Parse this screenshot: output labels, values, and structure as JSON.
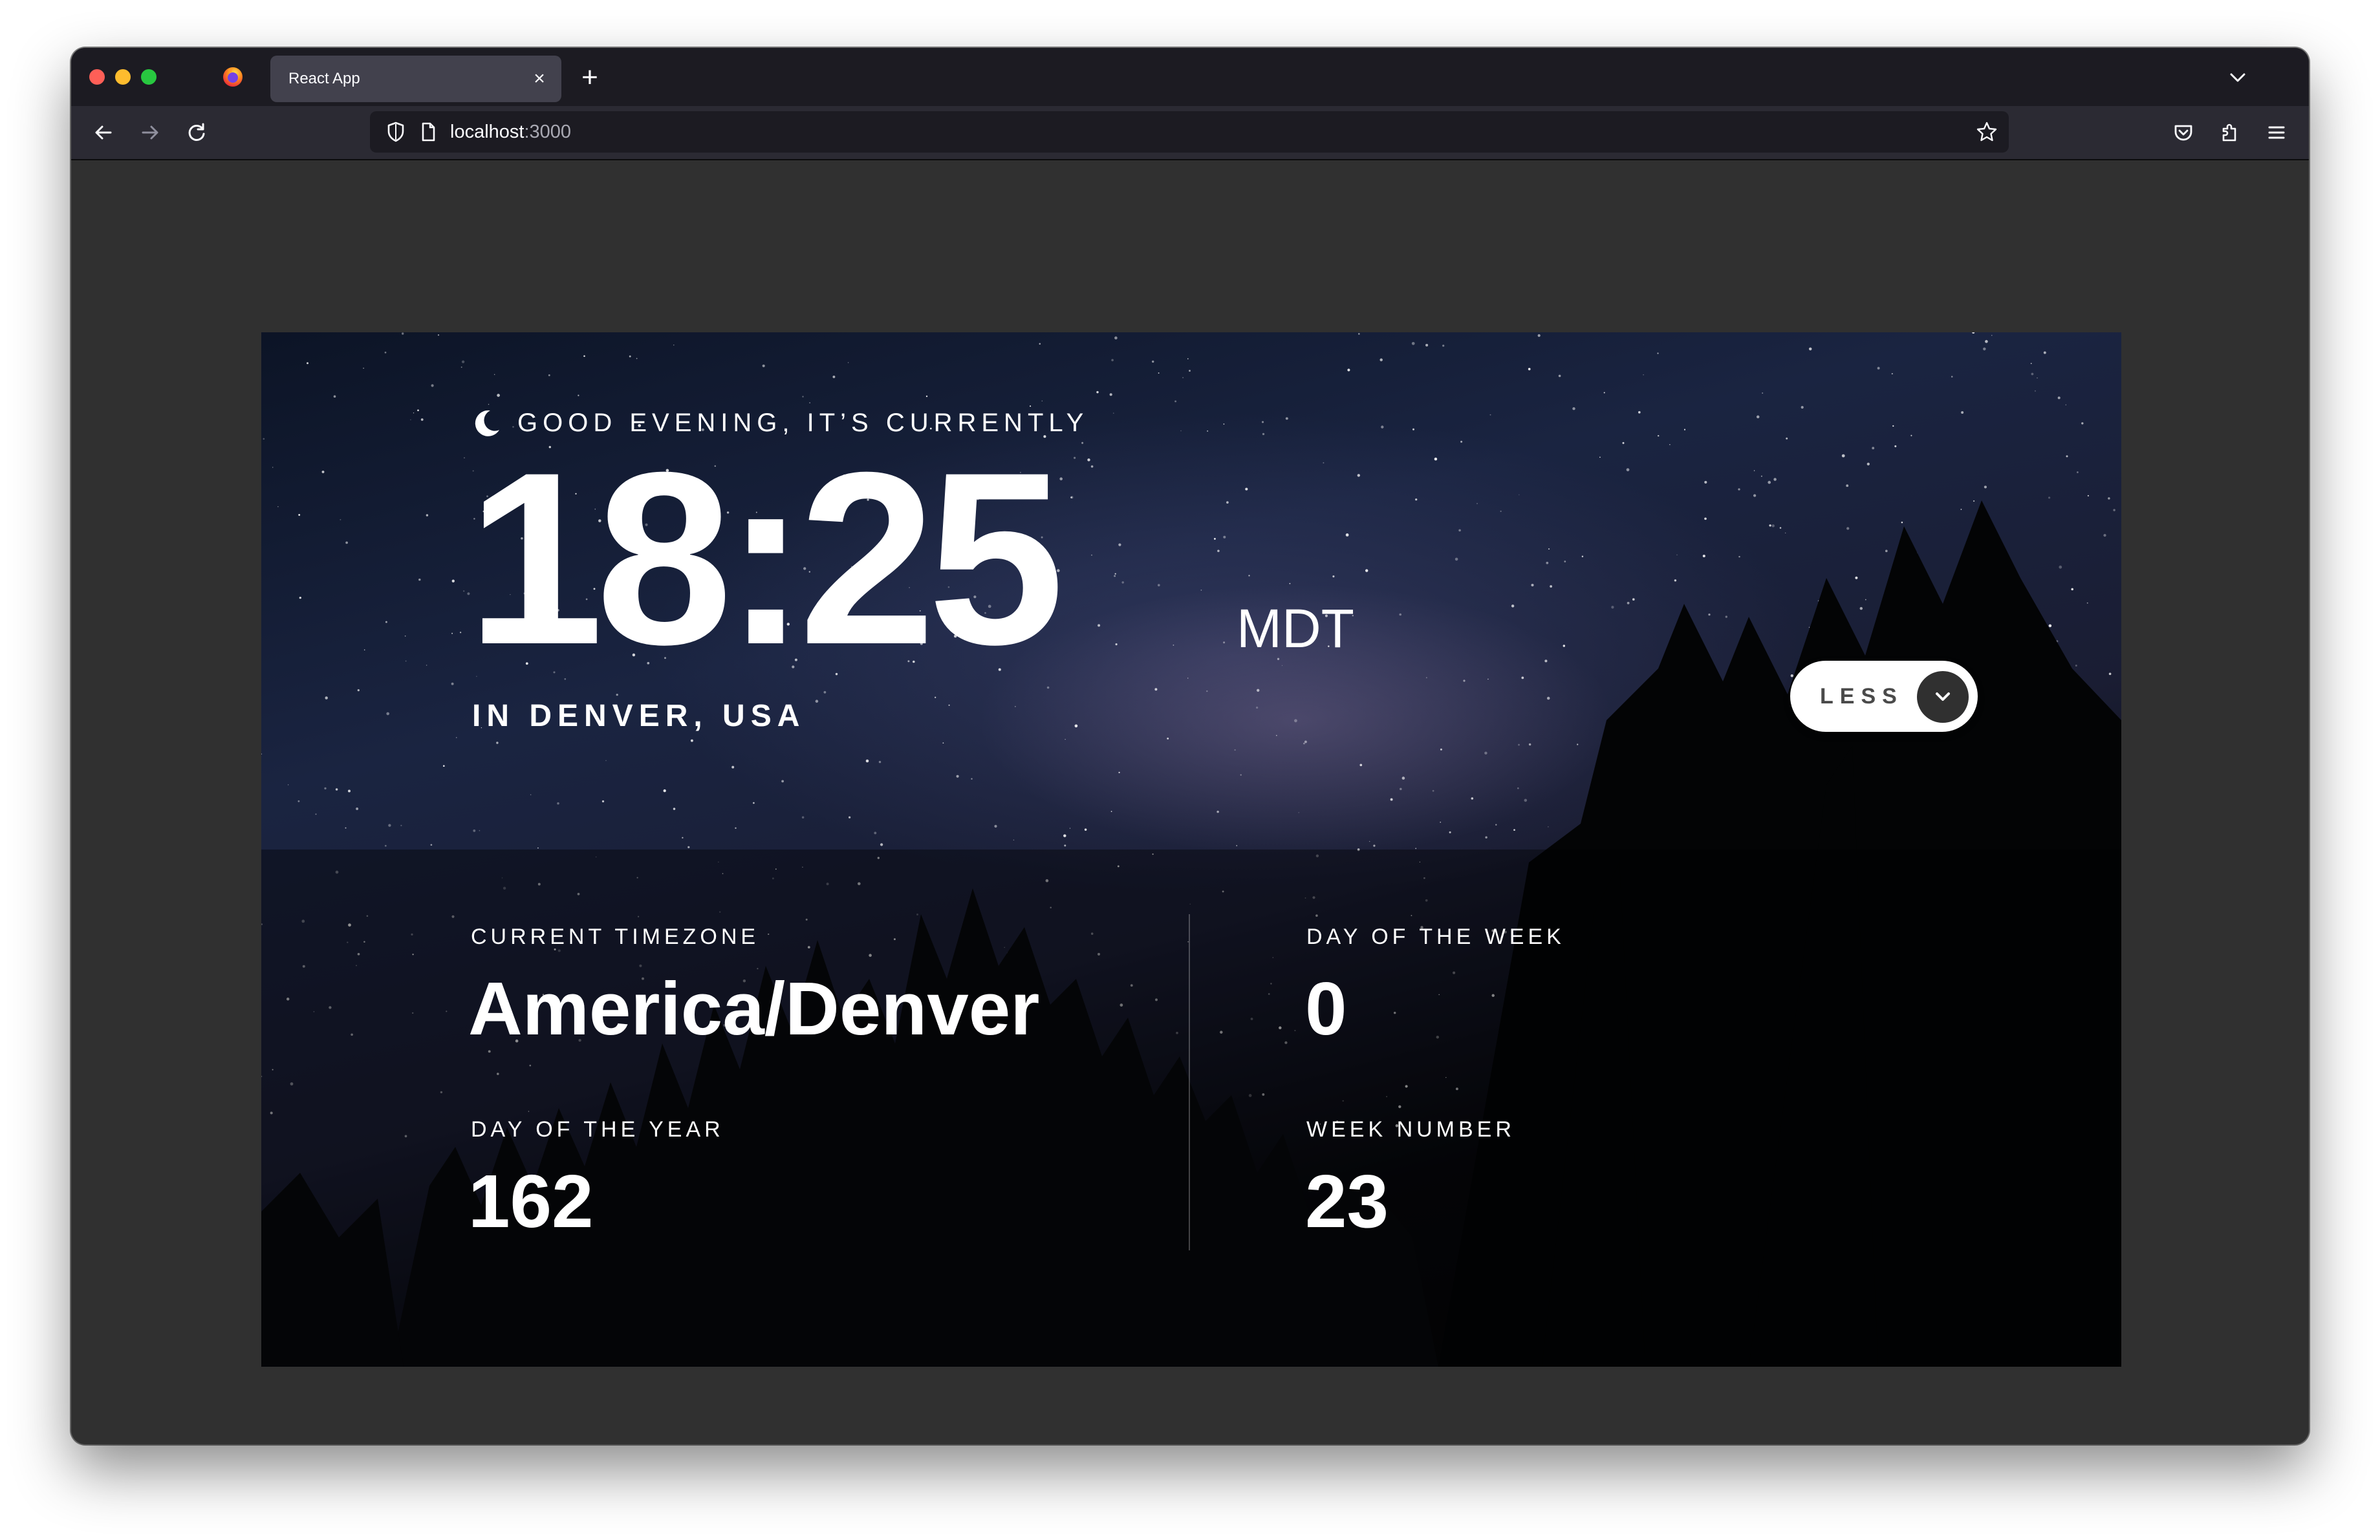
{
  "browser": {
    "tab_title": "React App",
    "tab_close": "×",
    "new_tab": "+",
    "url_host": "localhost",
    "url_port": ":3000"
  },
  "app": {
    "greeting": "GOOD EVENING, IT’S CURRENTLY",
    "time": "18:25",
    "timezone_abbr": "MDT",
    "location": "IN DENVER, USA",
    "toggle_label": "LESS",
    "details": {
      "current_timezone_label": "CURRENT TIMEZONE",
      "current_timezone_value": "America/Denver",
      "day_of_year_label": "DAY OF THE YEAR",
      "day_of_year_value": "162",
      "day_of_week_label": "DAY OF THE WEEK",
      "day_of_week_value": "0",
      "week_number_label": "WEEK NUMBER",
      "week_number_value": "23"
    }
  },
  "colors": {
    "tab_bar": "#1c1b22",
    "toolbar": "#2b2a33",
    "page_background": "#303030",
    "toggle_button": "#ffffff",
    "toggle_circle": "#303030"
  }
}
